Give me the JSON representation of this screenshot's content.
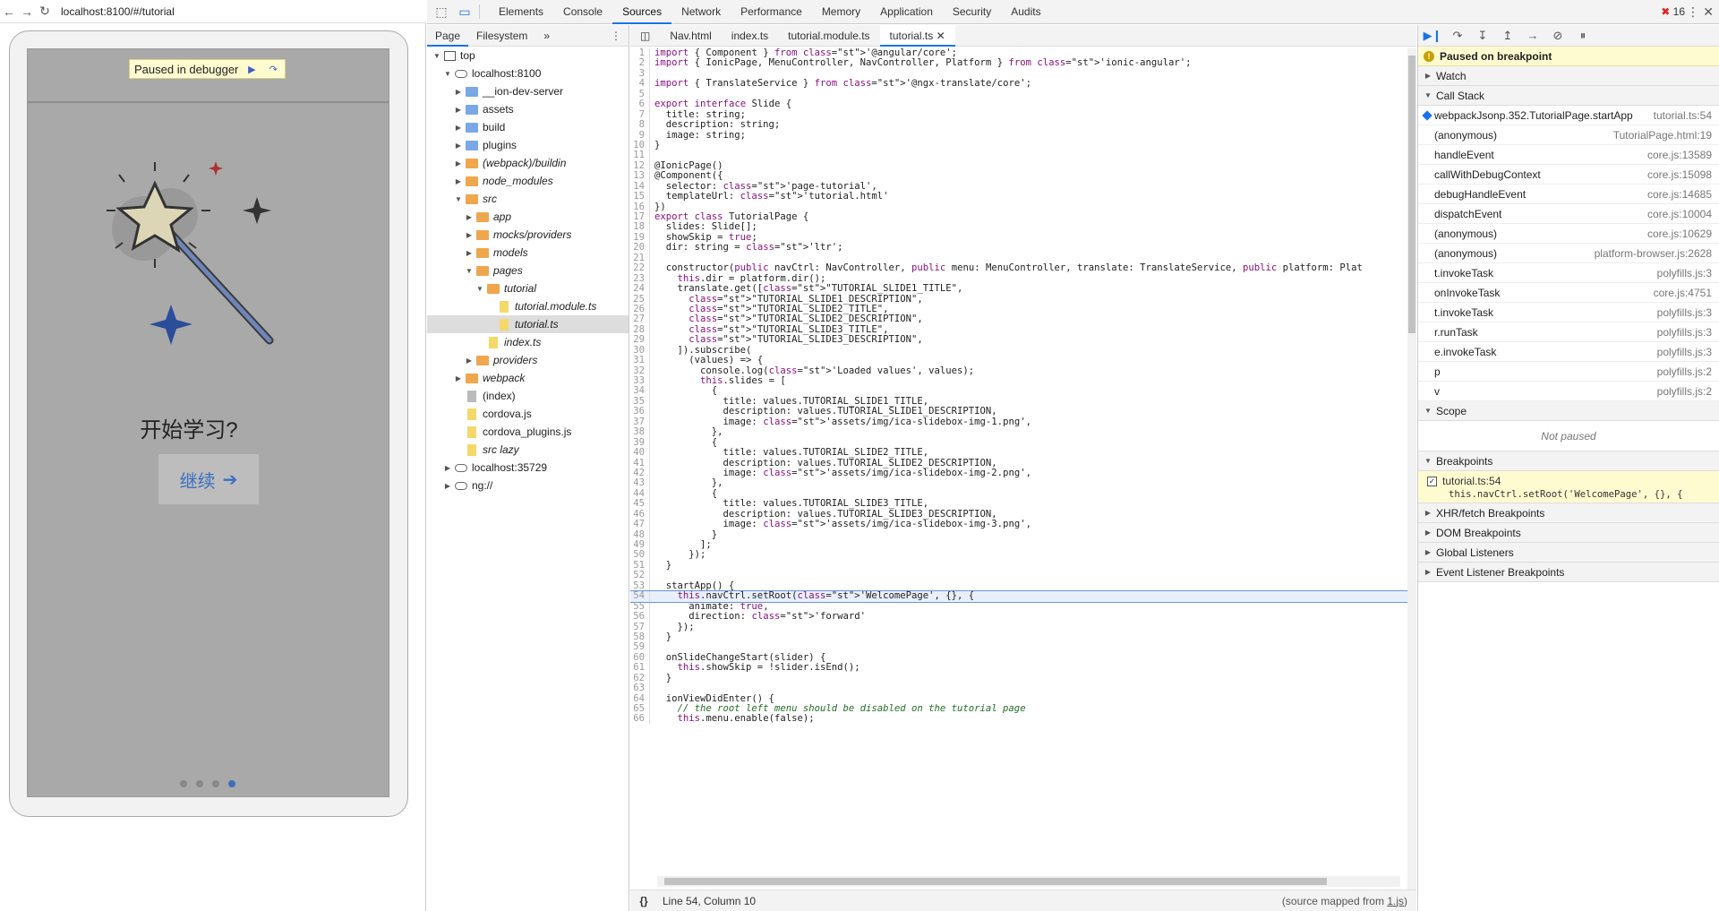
{
  "browser": {
    "url": "localhost:8100/#/tutorial",
    "paused_label": "Paused in debugger",
    "heading": "开始学习?",
    "continue_label": "继续",
    "page_dots": 4,
    "active_dot": 4
  },
  "devtools": {
    "tabs": [
      "Elements",
      "Console",
      "Sources",
      "Network",
      "Performance",
      "Memory",
      "Application",
      "Security",
      "Audits"
    ],
    "active_tab": "Sources",
    "error_count": "16",
    "navigator": {
      "tabs": [
        "Page",
        "Filesystem"
      ],
      "tree": [
        {
          "label": "top",
          "depth": 0,
          "kind": "frame",
          "open": true
        },
        {
          "label": "localhost:8100",
          "depth": 1,
          "kind": "cloud",
          "open": true
        },
        {
          "label": "__ion-dev-server",
          "depth": 2,
          "kind": "folder-blue",
          "open": false
        },
        {
          "label": "assets",
          "depth": 2,
          "kind": "folder-blue",
          "open": false
        },
        {
          "label": "build",
          "depth": 2,
          "kind": "folder-blue",
          "open": false
        },
        {
          "label": "plugins",
          "depth": 2,
          "kind": "folder-blue",
          "open": false
        },
        {
          "label": "(webpack)/buildin",
          "depth": 2,
          "kind": "folder-orange",
          "open": false,
          "italic": true
        },
        {
          "label": "node_modules",
          "depth": 2,
          "kind": "folder-orange",
          "open": false,
          "italic": true
        },
        {
          "label": "src",
          "depth": 2,
          "kind": "folder-orange",
          "open": true,
          "italic": true
        },
        {
          "label": "app",
          "depth": 3,
          "kind": "folder-orange",
          "open": false,
          "italic": true
        },
        {
          "label": "mocks/providers",
          "depth": 3,
          "kind": "folder-orange",
          "open": false,
          "italic": true
        },
        {
          "label": "models",
          "depth": 3,
          "kind": "folder-orange",
          "open": false,
          "italic": true
        },
        {
          "label": "pages",
          "depth": 3,
          "kind": "folder-orange",
          "open": true,
          "italic": true
        },
        {
          "label": "tutorial",
          "depth": 4,
          "kind": "folder-orange",
          "open": true,
          "italic": true
        },
        {
          "label": "tutorial.module.ts",
          "depth": 5,
          "kind": "file-y",
          "italic": true
        },
        {
          "label": "tutorial.ts",
          "depth": 5,
          "kind": "file-y",
          "italic": true,
          "selected": true
        },
        {
          "label": "index.ts",
          "depth": 4,
          "kind": "file-y",
          "italic": true
        },
        {
          "label": "providers",
          "depth": 3,
          "kind": "folder-orange",
          "open": false,
          "italic": true
        },
        {
          "label": "webpack",
          "depth": 2,
          "kind": "folder-orange",
          "open": false,
          "italic": true
        },
        {
          "label": "(index)",
          "depth": 2,
          "kind": "file-g"
        },
        {
          "label": "cordova.js",
          "depth": 2,
          "kind": "file-y"
        },
        {
          "label": "cordova_plugins.js",
          "depth": 2,
          "kind": "file-y"
        },
        {
          "label": "src lazy",
          "depth": 2,
          "kind": "file-y",
          "italic": true
        },
        {
          "label": "localhost:35729",
          "depth": 1,
          "kind": "cloud",
          "open": false
        },
        {
          "label": "ng://",
          "depth": 1,
          "kind": "cloud",
          "open": false
        }
      ]
    },
    "editor_tabs": [
      "Nav.html",
      "index.ts",
      "tutorial.module.ts",
      "tutorial.ts"
    ],
    "active_editor_tab": "tutorial.ts",
    "code": [
      "import { Component } from '@angular/core';",
      "import { IonicPage, MenuController, NavController, Platform } from 'ionic-angular';",
      "",
      "import { TranslateService } from '@ngx-translate/core';",
      "",
      "export interface Slide {",
      "  title: string;",
      "  description: string;",
      "  image: string;",
      "}",
      "",
      "@IonicPage()",
      "@Component({",
      "  selector: 'page-tutorial',",
      "  templateUrl: 'tutorial.html'",
      "})",
      "export class TutorialPage {",
      "  slides: Slide[];",
      "  showSkip = true;",
      "  dir: string = 'ltr';",
      "",
      "  constructor(public navCtrl: NavController, public menu: MenuController, translate: TranslateService, public platform: Plat",
      "    this.dir = platform.dir();",
      "    translate.get([\"TUTORIAL_SLIDE1_TITLE\",",
      "      \"TUTORIAL_SLIDE1_DESCRIPTION\",",
      "      \"TUTORIAL_SLIDE2_TITLE\",",
      "      \"TUTORIAL_SLIDE2_DESCRIPTION\",",
      "      \"TUTORIAL_SLIDE3_TITLE\",",
      "      \"TUTORIAL_SLIDE3_DESCRIPTION\",",
      "    ]).subscribe(",
      "      (values) => {",
      "        console.log('Loaded values', values);",
      "        this.slides = [",
      "          {",
      "            title: values.TUTORIAL_SLIDE1_TITLE,",
      "            description: values.TUTORIAL_SLIDE1_DESCRIPTION,",
      "            image: 'assets/img/ica-slidebox-img-1.png',",
      "          },",
      "          {",
      "            title: values.TUTORIAL_SLIDE2_TITLE,",
      "            description: values.TUTORIAL_SLIDE2_DESCRIPTION,",
      "            image: 'assets/img/ica-slidebox-img-2.png',",
      "          },",
      "          {",
      "            title: values.TUTORIAL_SLIDE3_TITLE,",
      "            description: values.TUTORIAL_SLIDE3_DESCRIPTION,",
      "            image: 'assets/img/ica-slidebox-img-3.png',",
      "          }",
      "        ];",
      "      });",
      "  }",
      "",
      "  startApp() {",
      "    this.navCtrl.setRoot('WelcomePage', {}, {",
      "      animate: true,",
      "      direction: 'forward'",
      "    });",
      "  }",
      "",
      "  onSlideChangeStart(slider) {",
      "    this.showSkip = !slider.isEnd();",
      "  }",
      "",
      "  ionViewDidEnter() {",
      "    // the root left menu should be disabled on the tutorial page",
      "    this.menu.enable(false);"
    ],
    "current_line": 54,
    "status": {
      "position": "Line 54, Column 10",
      "mapped_prefix": "(source mapped from ",
      "mapped_file": "1.js",
      "mapped_suffix": ")"
    },
    "sidebar": {
      "paused_msg": "Paused on breakpoint",
      "watch": "Watch",
      "call_stack_title": "Call Stack",
      "call_stack": [
        {
          "fn": "webpackJsonp.352.TutorialPage.startApp",
          "loc": "tutorial.ts:54",
          "current": true
        },
        {
          "fn": "(anonymous)",
          "loc": "TutorialPage.html:19"
        },
        {
          "fn": "handleEvent",
          "loc": "core.js:13589"
        },
        {
          "fn": "callWithDebugContext",
          "loc": "core.js:15098"
        },
        {
          "fn": "debugHandleEvent",
          "loc": "core.js:14685"
        },
        {
          "fn": "dispatchEvent",
          "loc": "core.js:10004"
        },
        {
          "fn": "(anonymous)",
          "loc": "core.js:10629"
        },
        {
          "fn": "(anonymous)",
          "loc": "platform-browser.js:2628"
        },
        {
          "fn": "t.invokeTask",
          "loc": "polyfills.js:3"
        },
        {
          "fn": "onInvokeTask",
          "loc": "core.js:4751"
        },
        {
          "fn": "t.invokeTask",
          "loc": "polyfills.js:3"
        },
        {
          "fn": "r.runTask",
          "loc": "polyfills.js:3"
        },
        {
          "fn": "e.invokeTask",
          "loc": "polyfills.js:3"
        },
        {
          "fn": "p",
          "loc": "polyfills.js:2"
        },
        {
          "fn": "v",
          "loc": "polyfills.js:2"
        }
      ],
      "scope_title": "Scope",
      "scope_empty": "Not paused",
      "breakpoints_title": "Breakpoints",
      "breakpoint_file": "tutorial.ts:54",
      "breakpoint_code": "this.navCtrl.setRoot('WelcomePage', {}, {",
      "sections": [
        "XHR/fetch Breakpoints",
        "DOM Breakpoints",
        "Global Listeners",
        "Event Listener Breakpoints"
      ]
    }
  }
}
